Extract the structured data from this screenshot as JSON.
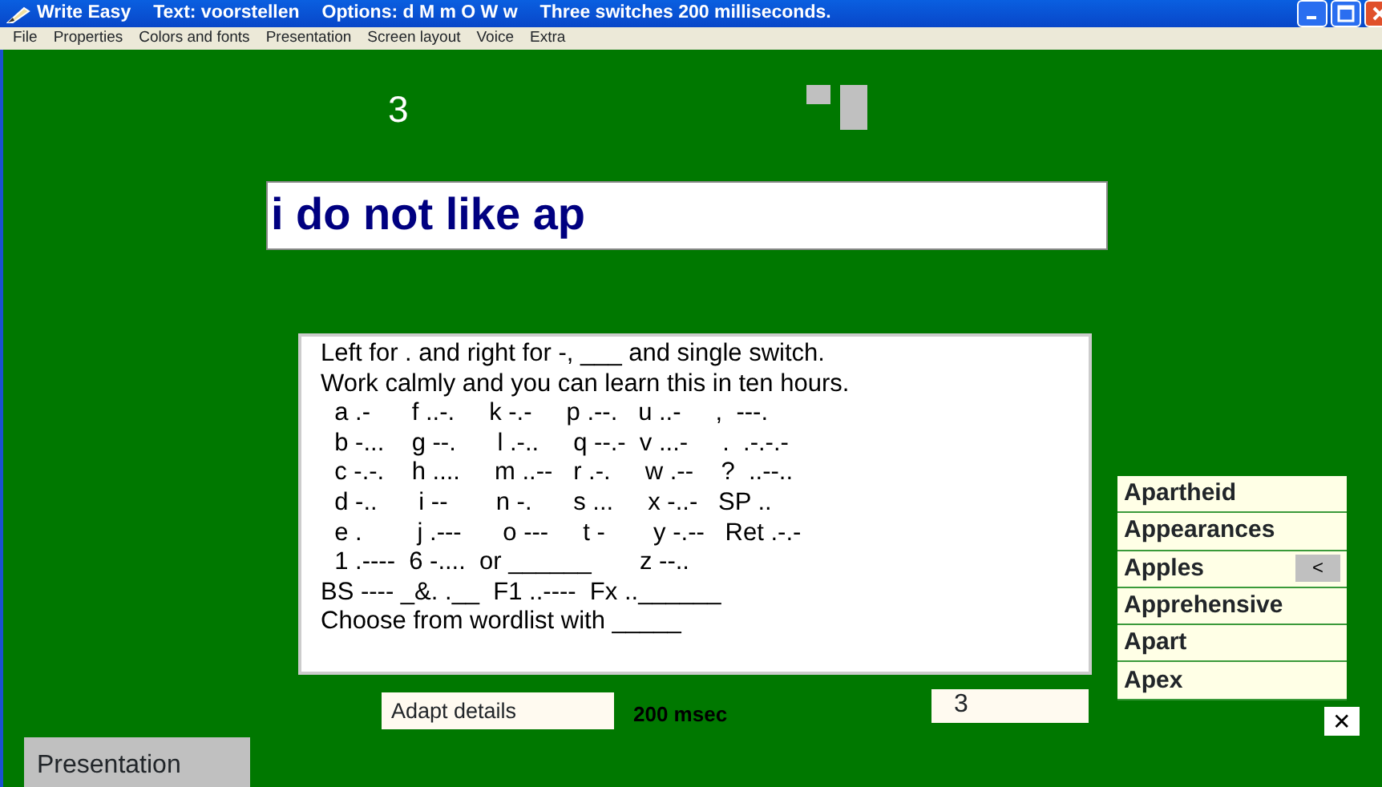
{
  "window": {
    "title": "Write Easy",
    "title_parts": [
      "Text: voorstellen",
      "Options: d M m O W w",
      "Three  switches 200 milliseconds."
    ]
  },
  "menu": [
    "File",
    "Properties",
    "Colors and fonts",
    "Presentation",
    "Screen layout",
    "Voice",
    "Extra"
  ],
  "counter": "3",
  "text_field": {
    "value": "i do not like ap"
  },
  "help_lines": [
    "Left for . and right for -, ___ and single switch.",
    "Work calmly and you can learn this in ten hours.",
    "  a .-      f ..-.     k -.-     p .--.   u ..-     ,  ---.",
    "  b -...    g --.      l .-..     q --.-  v ...-     .  .-.-.-",
    "  c -.-.    h ....     m ..--   r .-.     w .--    ?  ..--..",
    "  d -..      i --       n -.      s ...     x -..-   SP ..",
    "  e .        j .---      o ---     t -       y -.--   Ret .-.-",
    "  1 .----  6 -....  or ______       z --..",
    "BS ---- _&. .__  F1 ..----  Fx ..______",
    "Choose from wordlist with _____"
  ],
  "adapt_button": "Adapt details",
  "speed": "200 msec",
  "switch_count": "3",
  "wordlist": [
    {
      "word": "Apartheid"
    },
    {
      "word": "Appearances"
    },
    {
      "word": "Apples",
      "arrow": "<"
    },
    {
      "word": "Apprehensive"
    },
    {
      "word": "Apart"
    },
    {
      "word": "Apex"
    }
  ],
  "close_wordlist": "✕",
  "bottom_tab": "Presentation"
}
